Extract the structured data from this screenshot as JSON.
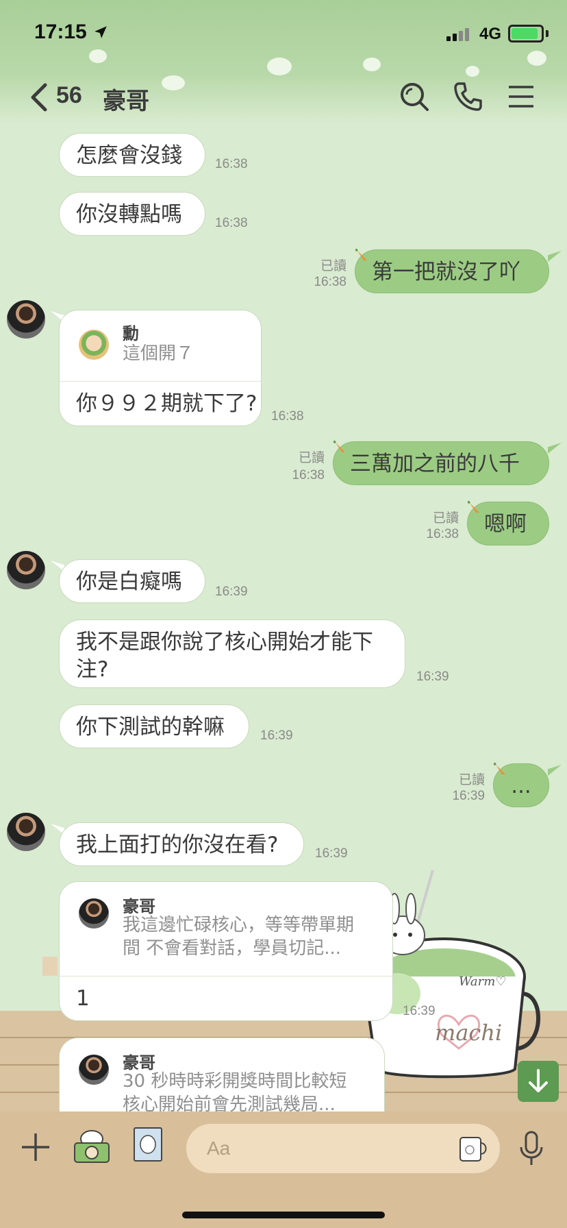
{
  "status_bar": {
    "time": "17:15",
    "network": "4G"
  },
  "header": {
    "unread_count": "56",
    "title": "豪哥"
  },
  "messages": [
    {
      "text": "怎麼會沒錢",
      "time": "16:38"
    },
    {
      "text": "你沒轉點嗎",
      "time": "16:38"
    },
    {
      "text": "第一把就沒了吖",
      "time": "16:38",
      "read": "已讀"
    },
    {
      "reply_name": "勳",
      "reply_text": "這個開７",
      "text": "你９９２期就下了?",
      "time": "16:38"
    },
    {
      "text": "三萬加之前的八千",
      "time": "16:38",
      "read": "已讀"
    },
    {
      "text": "嗯啊",
      "time": "16:38",
      "read": "已讀"
    },
    {
      "text": "你是白癡嗎",
      "time": "16:39"
    },
    {
      "text": "我不是跟你說了核心開始才能下\n注?",
      "time": "16:39"
    },
    {
      "text": "你下測試的幹嘛",
      "time": "16:39"
    },
    {
      "text": "...",
      "time": "16:39",
      "read": "已讀"
    },
    {
      "text": "我上面打的你沒在看?",
      "time": "16:39"
    },
    {
      "reply_name": "豪哥",
      "reply_text": "我這邊忙碌核心，等等帶單期\n間 不會看對話，學員切記...",
      "text": "1",
      "time": "16:39"
    },
    {
      "reply_name": "豪哥",
      "reply_text": "30 秒時時彩開獎時間比較短\n核心開始前會先測試幾局..."
    }
  ],
  "mug_text": "machi",
  "mug_warm_text": "Warm♡",
  "input": {
    "placeholder": "Aa"
  },
  "colors": {
    "my_bubble": "#9ccc84",
    "background": "#d9ebd0",
    "input_bar": "#d8bf99"
  },
  "icons": [
    "back-chevron-icon",
    "search-icon",
    "phone-icon",
    "menu-icon",
    "plus-icon",
    "camera-icon",
    "photo-icon",
    "sticker-icon",
    "microphone-icon",
    "scroll-down-icon"
  ]
}
